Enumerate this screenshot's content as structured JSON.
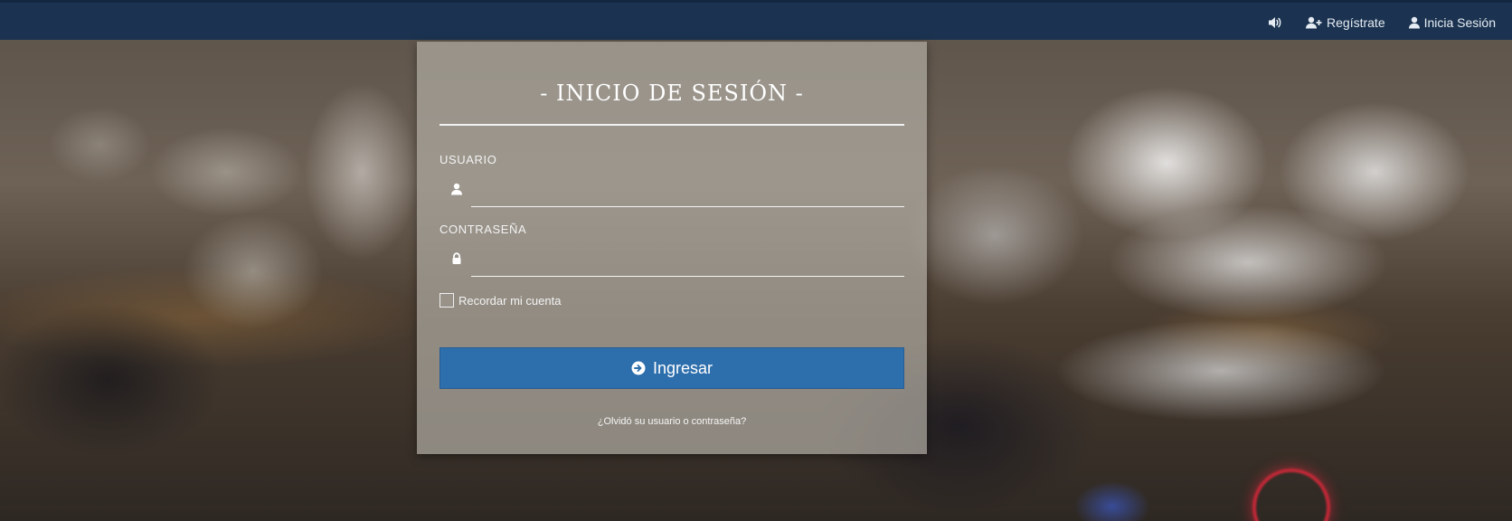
{
  "nav": {
    "sound_icon": "volume-icon",
    "register_icon": "user-plus-icon",
    "register_label": "Regístrate",
    "login_icon": "user-icon",
    "login_label": "Inicia Sesión"
  },
  "login": {
    "title": "- INICIO DE SESIÓN -",
    "username_label": "USUARIO",
    "username_value": "",
    "username_icon": "user-icon",
    "password_label": "CONTRASEÑA",
    "password_value": "",
    "password_icon": "lock-icon",
    "remember_label": "Recordar mi cuenta",
    "remember_checked": false,
    "submit_label": "Ingresar",
    "submit_icon": "arrow-circle-right-icon",
    "forgot_link": "¿Olvidó su usuario o contraseña?"
  },
  "colors": {
    "topbar": "#1b3350",
    "button": "#2d6eac"
  }
}
